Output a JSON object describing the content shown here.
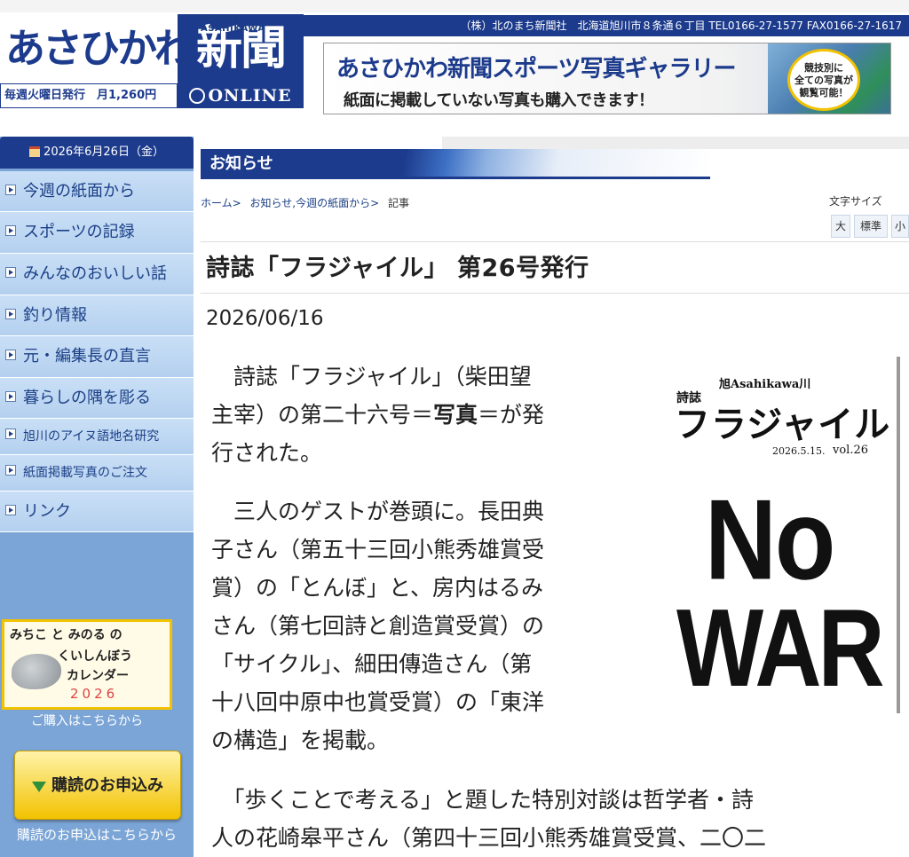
{
  "header": {
    "weekly_label": "WEEKLY ASAHIKAWA",
    "logo_left": "あさひかわ",
    "logo_right": "新聞",
    "issue_note": "毎週火曜日発行　月1,260円",
    "online": "ONLINE",
    "info": "（株）北のまち新聞社　北海道旭川市８条通６丁目 TEL0166-27-1577 FAX0166-27-1617"
  },
  "banner": {
    "line1": "あさひかわ新聞スポーツ写真ギャラリー",
    "line2": "紙面に掲載していない写真も購入できます！",
    "badge": [
      "競技別に",
      "全ての写真が",
      "観覧可能！"
    ]
  },
  "sidebar": {
    "date": "2026年6月26日（金）",
    "items": [
      {
        "label": "今週の紙面から"
      },
      {
        "label": "スポーツの記録"
      },
      {
        "label": "みんなのおいしい話"
      },
      {
        "label": "釣り情報"
      },
      {
        "label": "元・編集長の直言"
      },
      {
        "label": "暮らしの隅を彫る"
      },
      {
        "label": "旭川のアイヌ語地名研究"
      },
      {
        "label": "紙面掲載写真のご注文"
      },
      {
        "label": "リンク"
      }
    ],
    "calendar_ad": {
      "line1": "みちこ と みのる の",
      "line2": "くいしんぼう",
      "line3": "カレンダー",
      "year": "2026"
    },
    "calendar_note": "ご購入はこちらから",
    "subscribe_label": "購読のお申込み",
    "subscribe_note": "購読のお申込はこちらから"
  },
  "main": {
    "section_title": "お知らせ",
    "breadcrumb": [
      "ホーム>",
      "お知らせ,今週の紙面から>",
      "記事"
    ],
    "font_size": {
      "label": "文字サイズ",
      "large": "大",
      "normal": "標準",
      "small": "小"
    },
    "title": "詩誌「フラジャイル」 第26号発行",
    "date": "2026/06/16",
    "paragraph1": {
      "line1": "　詩誌「フラジャイル」（柴田望",
      "line2_pre": "主宰）の第二十六号＝",
      "line2_bold": "写真",
      "line2_post": "＝が発",
      "line3": "行された。"
    },
    "paragraph2": [
      "　三人のゲストが巻頭に。長田典",
      "子さん（第五十三回小熊秀雄賞受",
      "賞）の「とんぼ」と、房内はるみ",
      "さん（第七回詩と創造賞受賞）の",
      "「サイクル」、細田傳造さん（第",
      "十八回中原中也賞受賞）の「東洋",
      "の構造」を掲載。"
    ],
    "paragraph3": [
      "　「歩くことで考える」と題した特別対談は哲学者・詩",
      "人の花崎皋平さん（第四十三回小熊秀雄賞受賞、二〇二"
    ]
  },
  "cover": {
    "top": "旭Asahikawa川",
    "label": "詩誌",
    "title": "フラジャイル",
    "date": "2026.5.15.",
    "vol": "vol.26",
    "no": "No",
    "war": "WAR"
  },
  "colors": {
    "brand_navy": "#1d3b8c",
    "nav_bg": "#b4d0ef",
    "sidebar_bg": "#7ba5d6",
    "accent_yellow": "#f2c200"
  }
}
